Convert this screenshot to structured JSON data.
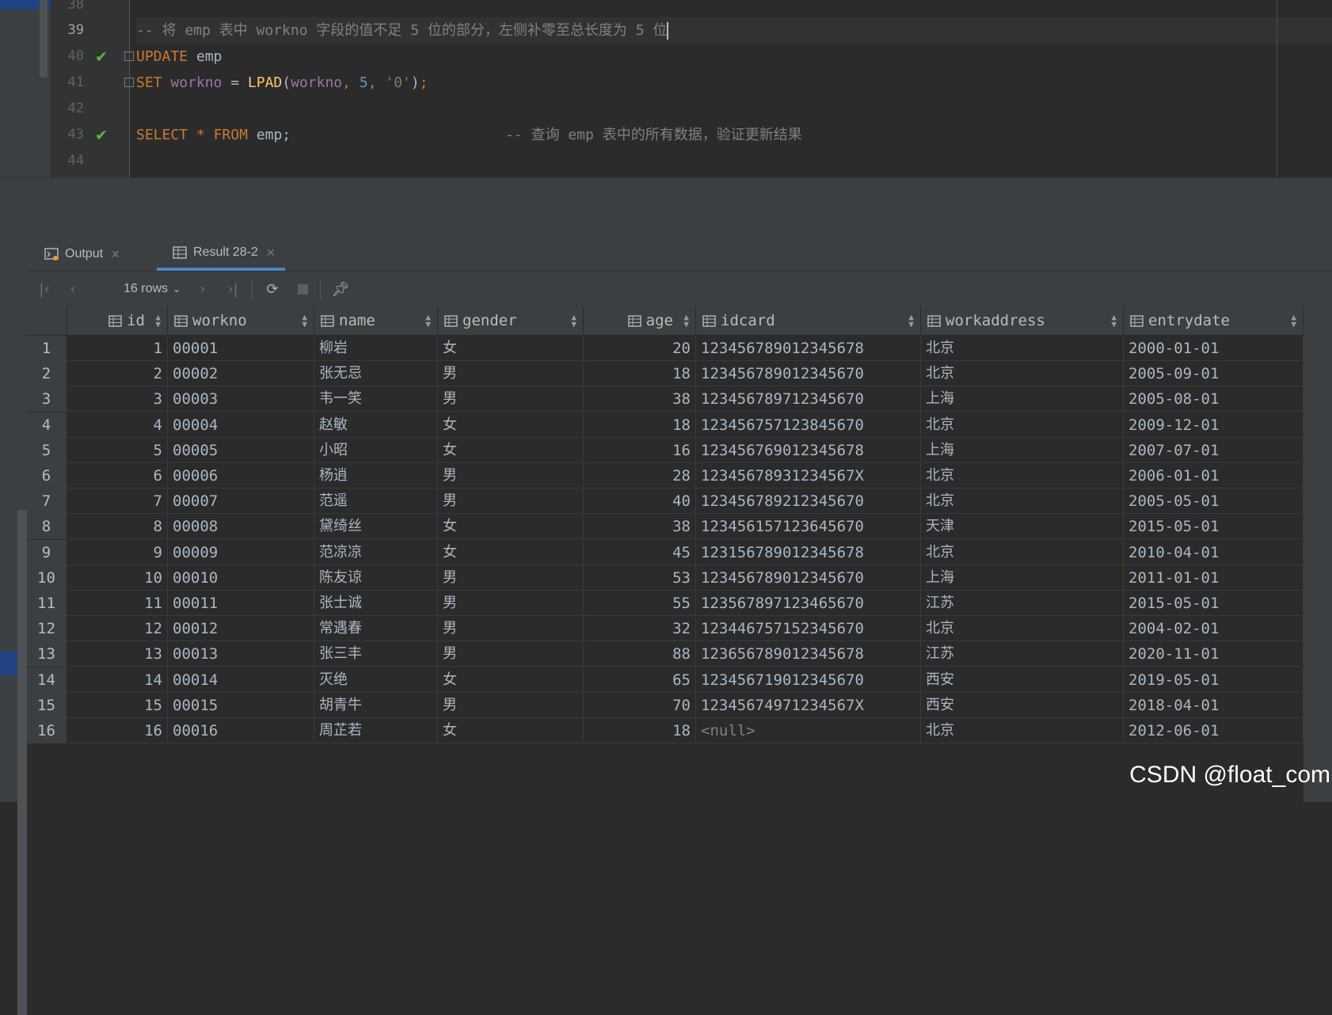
{
  "editor": {
    "lines": [
      {
        "num": "38"
      },
      {
        "num": "39",
        "comment": "-- 将 emp 表中 workno 字段的值不足 5 位的部分，左侧补零至总长度为 5 位"
      },
      {
        "num": "40",
        "kw": "UPDATE",
        "table": "emp"
      },
      {
        "num": "41",
        "kw": "SET",
        "col": "workno",
        "eq": "=",
        "fn": "LPAD",
        "arg_col": "workno",
        "arg_num": "5",
        "arg_str": "'0'"
      },
      {
        "num": "42"
      },
      {
        "num": "43",
        "kw1": "SELECT",
        "star": "*",
        "kw2": "FROM",
        "table": "emp;",
        "comment": "-- 查询 emp 表中的所有数据，验证更新结果"
      },
      {
        "num": "44"
      }
    ]
  },
  "tabs": [
    {
      "label": "Output",
      "icon": "console-icon"
    },
    {
      "label": "Result 28-2",
      "icon": "table-icon"
    }
  ],
  "toolbar": {
    "rows_label": "16 rows",
    "buttons": [
      "first-page-icon",
      "prev-page-icon",
      "next-page-icon",
      "last-page-icon",
      "refresh-icon",
      "stop-icon",
      "pin-icon"
    ]
  },
  "grid": {
    "columns": [
      "id",
      "workno",
      "name",
      "gender",
      "age",
      "idcard",
      "workaddress",
      "entrydate"
    ],
    "rows": [
      [
        "1",
        "00001",
        "柳岩",
        "女",
        "20",
        "123456789012345678",
        "北京",
        "2000-01-01"
      ],
      [
        "2",
        "00002",
        "张无忌",
        "男",
        "18",
        "123456789012345670",
        "北京",
        "2005-09-01"
      ],
      [
        "3",
        "00003",
        "韦一笑",
        "男",
        "38",
        "123456789712345670",
        "上海",
        "2005-08-01"
      ],
      [
        "4",
        "00004",
        "赵敏",
        "女",
        "18",
        "123456757123845670",
        "北京",
        "2009-12-01"
      ],
      [
        "5",
        "00005",
        "小昭",
        "女",
        "16",
        "123456769012345678",
        "上海",
        "2007-07-01"
      ],
      [
        "6",
        "00006",
        "杨逍",
        "男",
        "28",
        "12345678931234567X",
        "北京",
        "2006-01-01"
      ],
      [
        "7",
        "00007",
        "范遥",
        "男",
        "40",
        "123456789212345670",
        "北京",
        "2005-05-01"
      ],
      [
        "8",
        "00008",
        "黛绮丝",
        "女",
        "38",
        "123456157123645670",
        "天津",
        "2015-05-01"
      ],
      [
        "9",
        "00009",
        "范凉凉",
        "女",
        "45",
        "123156789012345678",
        "北京",
        "2010-04-01"
      ],
      [
        "10",
        "00010",
        "陈友谅",
        "男",
        "53",
        "123456789012345670",
        "上海",
        "2011-01-01"
      ],
      [
        "11",
        "00011",
        "张士诚",
        "男",
        "55",
        "123567897123465670",
        "江苏",
        "2015-05-01"
      ],
      [
        "12",
        "00012",
        "常遇春",
        "男",
        "32",
        "123446757152345670",
        "北京",
        "2004-02-01"
      ],
      [
        "13",
        "00013",
        "张三丰",
        "男",
        "88",
        "123656789012345678",
        "江苏",
        "2020-11-01"
      ],
      [
        "14",
        "00014",
        "灭绝",
        "女",
        "65",
        "123456719012345670",
        "西安",
        "2019-05-01"
      ],
      [
        "15",
        "00015",
        "胡青牛",
        "男",
        "70",
        "12345674971234567X",
        "西安",
        "2018-04-01"
      ],
      [
        "16",
        "00016",
        "周芷若",
        "女",
        "18",
        "<null>",
        "北京",
        "2012-06-01"
      ]
    ]
  },
  "watermark": "CSDN @float_com",
  "colors": {
    "keyword": "#cc7832",
    "identifier": "#9876aa",
    "function": "#ffc66d",
    "number": "#6897bb",
    "string": "#6a8759",
    "comment": "#808080",
    "check": "#5fb540",
    "accent": "#4a88c7"
  }
}
